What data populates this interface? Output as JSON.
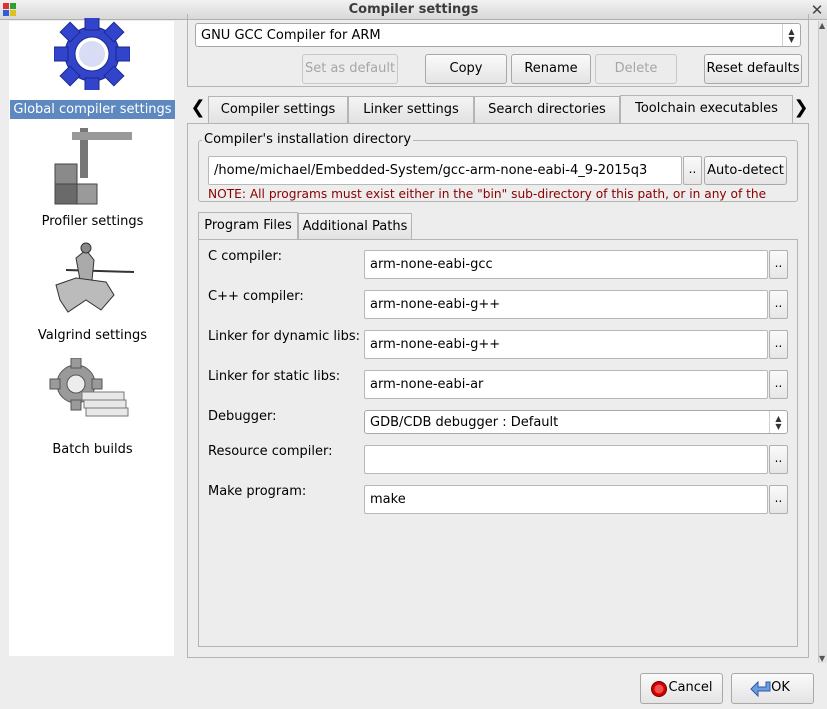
{
  "window": {
    "title": "Compiler settings"
  },
  "sidebar": {
    "items": [
      {
        "label": "Global compiler settings",
        "icon": "gear-icon",
        "selected": true
      },
      {
        "label": "Profiler settings",
        "icon": "caliper-icon"
      },
      {
        "label": "Valgrind settings",
        "icon": "knight-icon"
      },
      {
        "label": "Batch builds",
        "icon": "batch-gear-icon"
      }
    ]
  },
  "compiler": {
    "selected": "GNU GCC Compiler for ARM",
    "buttons": {
      "set_default": "Set as default",
      "copy": "Copy",
      "rename": "Rename",
      "delete": "Delete",
      "reset": "Reset defaults"
    }
  },
  "tabs": [
    "Compiler settings",
    "Linker settings",
    "Search directories",
    "Toolchain executables"
  ],
  "install": {
    "group_label": "Compiler's installation directory",
    "path": "/home/michael/Embedded-System/gcc-arm-none-eabi-4_9-2015q3",
    "browse": "..",
    "autodetect": "Auto-detect",
    "note": "NOTE: All programs must exist either in the \"bin\" sub-directory of this path, or in any of the"
  },
  "subtabs": [
    "Program Files",
    "Additional Paths"
  ],
  "programs": {
    "c_compiler": {
      "label": "C compiler:",
      "value": "arm-none-eabi-gcc"
    },
    "cpp_compiler": {
      "label": "C++ compiler:",
      "value": "arm-none-eabi-g++"
    },
    "linker_dynamic": {
      "label": "Linker for dynamic libs:",
      "value": "arm-none-eabi-g++"
    },
    "linker_static": {
      "label": "Linker for static libs:",
      "value": "arm-none-eabi-ar"
    },
    "debugger": {
      "label": "Debugger:",
      "value": "GDB/CDB debugger : Default"
    },
    "resource": {
      "label": "Resource compiler:",
      "value": ""
    },
    "make": {
      "label": "Make program:",
      "value": "make"
    },
    "browse": ".."
  },
  "dialog": {
    "cancel": "Cancel",
    "ok": "OK"
  },
  "colors": {
    "selection": "#5d88c0",
    "note": "#8b0000",
    "cancel_icon": "#d40000",
    "ok_icon": "#3a6fc4"
  }
}
